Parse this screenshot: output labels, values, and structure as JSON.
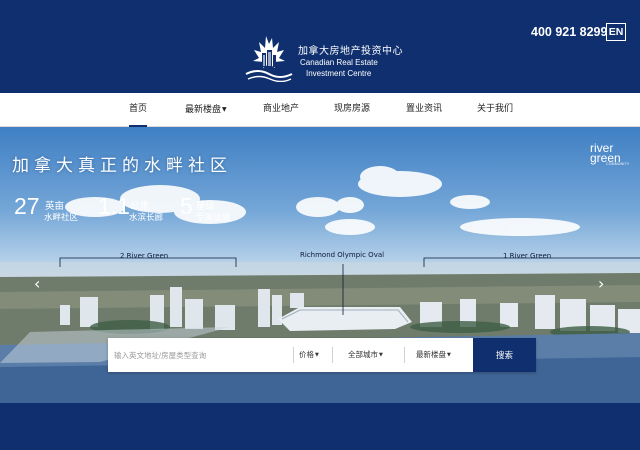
{
  "header": {
    "logo_cn": "加拿大房地产投资中心",
    "logo_en_line1": "Canadian Real Estate",
    "logo_en_line2": "Investment Centre",
    "phone": "400 921 8299",
    "lang_label": "EN"
  },
  "nav": {
    "items": [
      {
        "label": "首页",
        "active": true
      },
      {
        "label": "最新楼盘",
        "dropdown": true
      },
      {
        "label": "商业地产"
      },
      {
        "label": "现房房源"
      },
      {
        "label": "置业资讯"
      },
      {
        "label": "关于我们"
      }
    ]
  },
  "hero": {
    "title": "加拿大真正的水畔社区",
    "stats": [
      {
        "number": "27",
        "unit": "英亩",
        "desc": "水畔社区"
      },
      {
        "number": "1.1",
        "unit": "公里",
        "desc": "水滨长廊"
      },
      {
        "number": "5",
        "unit": "星级",
        "desc": "专属设施"
      }
    ],
    "brand": {
      "line1": "river",
      "line2": "green",
      "line3": "COMMUNITY"
    },
    "labels": {
      "left": "2 River Green",
      "center": "Richmond Olympic Oval",
      "right": "1 River Green"
    },
    "prev_arrow": "‹",
    "next_arrow": "›"
  },
  "search": {
    "placeholder": "输入英文地址/房屋类型查询",
    "price_label": "价格",
    "city_label": "全部城市",
    "projects_label": "最新楼盘",
    "button_label": "搜索"
  },
  "colors": {
    "brand_navy": "#0f2f6e",
    "nav_bg": "#ffffff"
  }
}
